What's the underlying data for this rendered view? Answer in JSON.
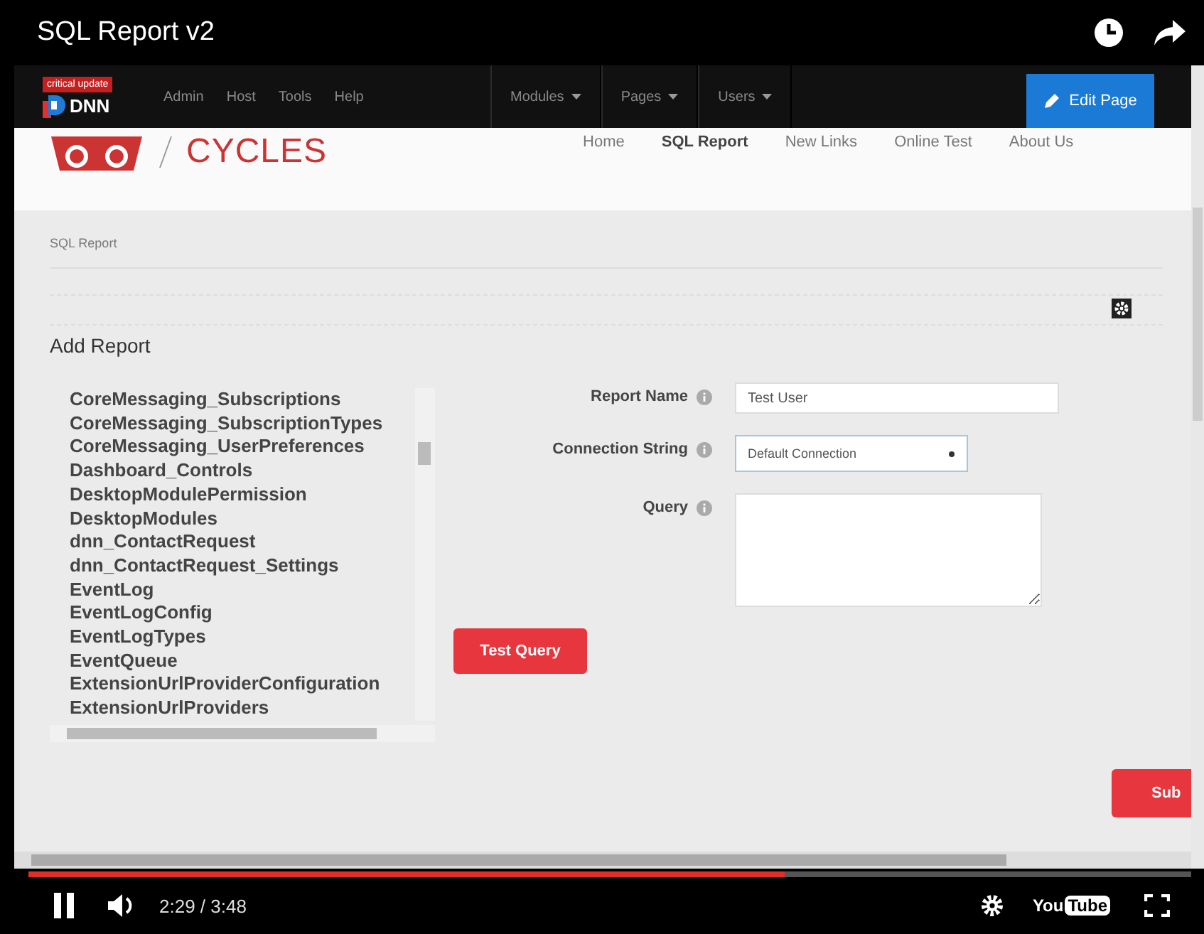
{
  "player": {
    "title": "SQL Report v2",
    "playing": true,
    "time": "2:29 / 3:48",
    "progress": {
      "level": 0.65
    },
    "brand": {
      "left": "You",
      "right": "Tube"
    }
  },
  "admin_bar": {
    "badge": "critical update",
    "logo": "DNN",
    "links": [
      "Admin",
      "Host",
      "Tools",
      "Help"
    ],
    "menus": [
      "Modules",
      "Pages",
      "Users"
    ],
    "edit_button": "Edit Page"
  },
  "site": {
    "logo_text": "CYCLES",
    "nav": [
      {
        "label": "Home",
        "selected": false
      },
      {
        "label": "SQL Report",
        "selected": true
      },
      {
        "label": "New Links",
        "selected": false
      },
      {
        "label": "Online Test",
        "selected": false
      },
      {
        "label": "About Us",
        "selected": false
      }
    ]
  },
  "breadcrumb": "SQL Report",
  "section_title": "Add Report",
  "tables": [
    "CoreMessaging_Subscriptions",
    "CoreMessaging_SubscriptionTypes",
    "CoreMessaging_UserPreferences",
    "Dashboard_Controls",
    "DesktopModulePermission",
    "DesktopModules",
    "dnn_ContactRequest",
    "dnn_ContactRequest_Settings",
    "EventLog",
    "EventLogConfig",
    "EventLogTypes",
    "EventQueue",
    "ExtensionUrlProviderConfiguration",
    "ExtensionUrlProviders"
  ],
  "form": {
    "fields": [
      {
        "kind": "text",
        "label": "Report Name",
        "value": "Test User"
      },
      {
        "kind": "select",
        "label": "Connection String",
        "value": "Default Connection"
      },
      {
        "kind": "textarea",
        "label": "Query"
      }
    ],
    "test_button": "Test Query",
    "submit_button": "Sub"
  }
}
